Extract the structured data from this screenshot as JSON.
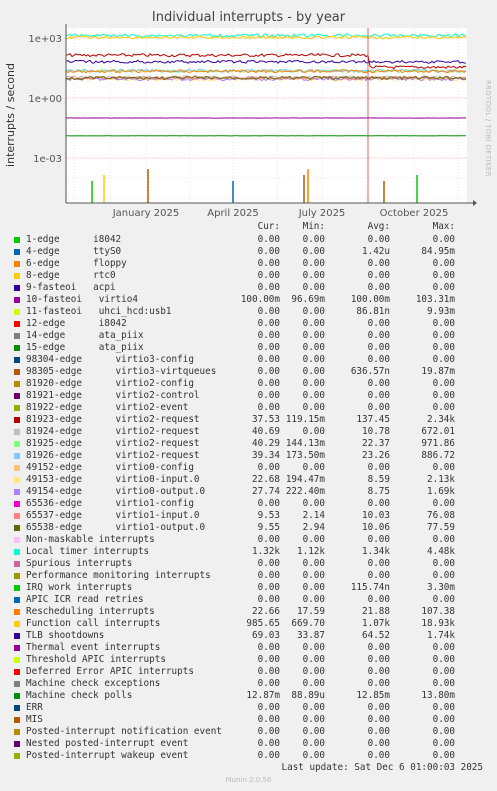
{
  "chart_data": {
    "type": "line",
    "title": "Individual interrupts - by year",
    "ylabel": "interrupts / second",
    "yscale": "log",
    "ytick_labels": [
      "1e+03",
      "1e+00",
      "1e-03"
    ],
    "xtick_labels": [
      "January 2025",
      "April 2025",
      "July 2025",
      "October 2025"
    ],
    "grid": true,
    "columns": [
      "Cur:",
      "Min:",
      "Avg:",
      "Max:"
    ],
    "series": [
      {
        "name": "1-edge      i8042",
        "color": "#00cc00",
        "cur": "0.00",
        "min": "0.00",
        "avg": "0.00",
        "max": "0.00"
      },
      {
        "name": "4-edge      ttyS0",
        "color": "#0066b3",
        "cur": "0.00",
        "min": "0.00",
        "avg": "1.42u",
        "max": "84.95m"
      },
      {
        "name": "6-edge      floppy",
        "color": "#ff8000",
        "cur": "0.00",
        "min": "0.00",
        "avg": "0.00",
        "max": "0.00"
      },
      {
        "name": "8-edge      rtc0",
        "color": "#ffcc00",
        "cur": "0.00",
        "min": "0.00",
        "avg": "0.00",
        "max": "0.00"
      },
      {
        "name": "9-fasteoi   acpi",
        "color": "#330099",
        "cur": "0.00",
        "min": "0.00",
        "avg": "0.00",
        "max": "0.00"
      },
      {
        "name": "10-fasteoi   virtio4",
        "color": "#990099",
        "cur": "100.00m",
        "min": "96.69m",
        "avg": "100.00m",
        "max": "103.31m"
      },
      {
        "name": "11-fasteoi   uhci_hcd:usb1",
        "color": "#ccff00",
        "cur": "0.00",
        "min": "0.00",
        "avg": "86.81n",
        "max": "9.93m"
      },
      {
        "name": "12-edge      i8042",
        "color": "#ff0000",
        "cur": "0.00",
        "min": "0.00",
        "avg": "0.00",
        "max": "0.00"
      },
      {
        "name": "14-edge      ata_piix",
        "color": "#808080",
        "cur": "0.00",
        "min": "0.00",
        "avg": "0.00",
        "max": "0.00"
      },
      {
        "name": "15-edge      ata_piix",
        "color": "#008f00",
        "cur": "0.00",
        "min": "0.00",
        "avg": "0.00",
        "max": "0.00"
      },
      {
        "name": "98304-edge      virtio3-config",
        "color": "#00487d",
        "cur": "0.00",
        "min": "0.00",
        "avg": "0.00",
        "max": "0.00"
      },
      {
        "name": "98305-edge      virtio3-virtqueues",
        "color": "#b35a00",
        "cur": "0.00",
        "min": "0.00",
        "avg": "636.57n",
        "max": "19.87m"
      },
      {
        "name": "81920-edge      virtio2-config",
        "color": "#b38f00",
        "cur": "0.00",
        "min": "0.00",
        "avg": "0.00",
        "max": "0.00"
      },
      {
        "name": "81921-edge      virtio2-control",
        "color": "#6b006b",
        "cur": "0.00",
        "min": "0.00",
        "avg": "0.00",
        "max": "0.00"
      },
      {
        "name": "81922-edge      virtio2-event",
        "color": "#8fb300",
        "cur": "0.00",
        "min": "0.00",
        "avg": "0.00",
        "max": "0.00"
      },
      {
        "name": "81923-edge      virtio2-request",
        "color": "#b30000",
        "cur": "37.53",
        "min": "119.15m",
        "avg": "137.45",
        "max": "2.34k"
      },
      {
        "name": "81924-edge      virtio2-request",
        "color": "#bebebe",
        "cur": "40.69",
        "min": "0.00",
        "avg": "10.78",
        "max": "672.01"
      },
      {
        "name": "81925-edge      virtio2-request",
        "color": "#80ff80",
        "cur": "40.29",
        "min": "144.13m",
        "avg": "22.37",
        "max": "971.86"
      },
      {
        "name": "81926-edge      virtio2-request",
        "color": "#80c9ff",
        "cur": "39.34",
        "min": "173.50m",
        "avg": "23.26",
        "max": "886.72"
      },
      {
        "name": "49152-edge      virtio0-config",
        "color": "#ffc080",
        "cur": "0.00",
        "min": "0.00",
        "avg": "0.00",
        "max": "0.00"
      },
      {
        "name": "49153-edge      virtio0-input.0",
        "color": "#ffe680",
        "cur": "22.68",
        "min": "194.47m",
        "avg": "8.59",
        "max": "2.13k"
      },
      {
        "name": "49154-edge      virtio0-output.0",
        "color": "#aa80ff",
        "cur": "27.74",
        "min": "222.40m",
        "avg": "8.75",
        "max": "1.69k"
      },
      {
        "name": "65536-edge      virtio1-config",
        "color": "#ee00cc",
        "cur": "0.00",
        "min": "0.00",
        "avg": "0.00",
        "max": "0.00"
      },
      {
        "name": "65537-edge      virtio1-input.0",
        "color": "#ff8080",
        "cur": "9.53",
        "min": "2.14",
        "avg": "10.03",
        "max": "76.08"
      },
      {
        "name": "65538-edge      virtio1-output.0",
        "color": "#666600",
        "cur": "9.55",
        "min": "2.94",
        "avg": "10.06",
        "max": "77.59"
      },
      {
        "name": "Non-maskable interrupts",
        "color": "#ffbfff",
        "cur": "0.00",
        "min": "0.00",
        "avg": "0.00",
        "max": "0.00"
      },
      {
        "name": "Local timer interrupts",
        "color": "#00ffcc",
        "cur": "1.32k",
        "min": "1.12k",
        "avg": "1.34k",
        "max": "4.48k"
      },
      {
        "name": "Spurious interrupts",
        "color": "#cc6699",
        "cur": "0.00",
        "min": "0.00",
        "avg": "0.00",
        "max": "0.00"
      },
      {
        "name": "Performance monitoring interrupts",
        "color": "#999900",
        "cur": "0.00",
        "min": "0.00",
        "avg": "0.00",
        "max": "0.00"
      },
      {
        "name": "IRQ work interrupts",
        "color": "#00cc00",
        "cur": "0.00",
        "min": "0.00",
        "avg": "115.74n",
        "max": "3.30m"
      },
      {
        "name": "APIC ICR read retries",
        "color": "#0066b3",
        "cur": "0.00",
        "min": "0.00",
        "avg": "0.00",
        "max": "0.00"
      },
      {
        "name": "Rescheduling interrupts",
        "color": "#ff8000",
        "cur": "22.66",
        "min": "17.59",
        "avg": "21.88",
        "max": "107.38"
      },
      {
        "name": "Function call interrupts",
        "color": "#ffcc00",
        "cur": "985.65",
        "min": "669.70",
        "avg": "1.07k",
        "max": "18.93k"
      },
      {
        "name": "TLB shootdowns",
        "color": "#330099",
        "cur": "69.03",
        "min": "33.87",
        "avg": "64.52",
        "max": "1.74k"
      },
      {
        "name": "Thermal event interrupts",
        "color": "#990099",
        "cur": "0.00",
        "min": "0.00",
        "avg": "0.00",
        "max": "0.00"
      },
      {
        "name": "Threshold APIC interrupts",
        "color": "#ccff00",
        "cur": "0.00",
        "min": "0.00",
        "avg": "0.00",
        "max": "0.00"
      },
      {
        "name": "Deferred Error APIC interrupts",
        "color": "#ff0000",
        "cur": "0.00",
        "min": "0.00",
        "avg": "0.00",
        "max": "0.00"
      },
      {
        "name": "Machine check exceptions",
        "color": "#808080",
        "cur": "0.00",
        "min": "0.00",
        "avg": "0.00",
        "max": "0.00"
      },
      {
        "name": "Machine check polls",
        "color": "#008f00",
        "cur": "12.87m",
        "min": "88.89u",
        "avg": "12.85m",
        "max": "13.80m"
      },
      {
        "name": "ERR",
        "color": "#00487d",
        "cur": "0.00",
        "min": "0.00",
        "avg": "0.00",
        "max": "0.00"
      },
      {
        "name": "MIS",
        "color": "#b35a00",
        "cur": "0.00",
        "min": "0.00",
        "avg": "0.00",
        "max": "0.00"
      },
      {
        "name": "Posted-interrupt notification event",
        "color": "#b38f00",
        "cur": "0.00",
        "min": "0.00",
        "avg": "0.00",
        "max": "0.00"
      },
      {
        "name": "Nested posted-interrupt event",
        "color": "#6b006b",
        "cur": "0.00",
        "min": "0.00",
        "avg": "0.00",
        "max": "0.00"
      },
      {
        "name": "Posted-interrupt wakeup event",
        "color": "#8fb300",
        "cur": "0.00",
        "min": "0.00",
        "avg": "0.00",
        "max": "0.00"
      }
    ]
  },
  "side_label": "RRDTOOL / TOBI OETIKER",
  "last_update": "Last update: Sat Dec  6 01:00:03 2025",
  "footer": "Munin 2.0.56"
}
